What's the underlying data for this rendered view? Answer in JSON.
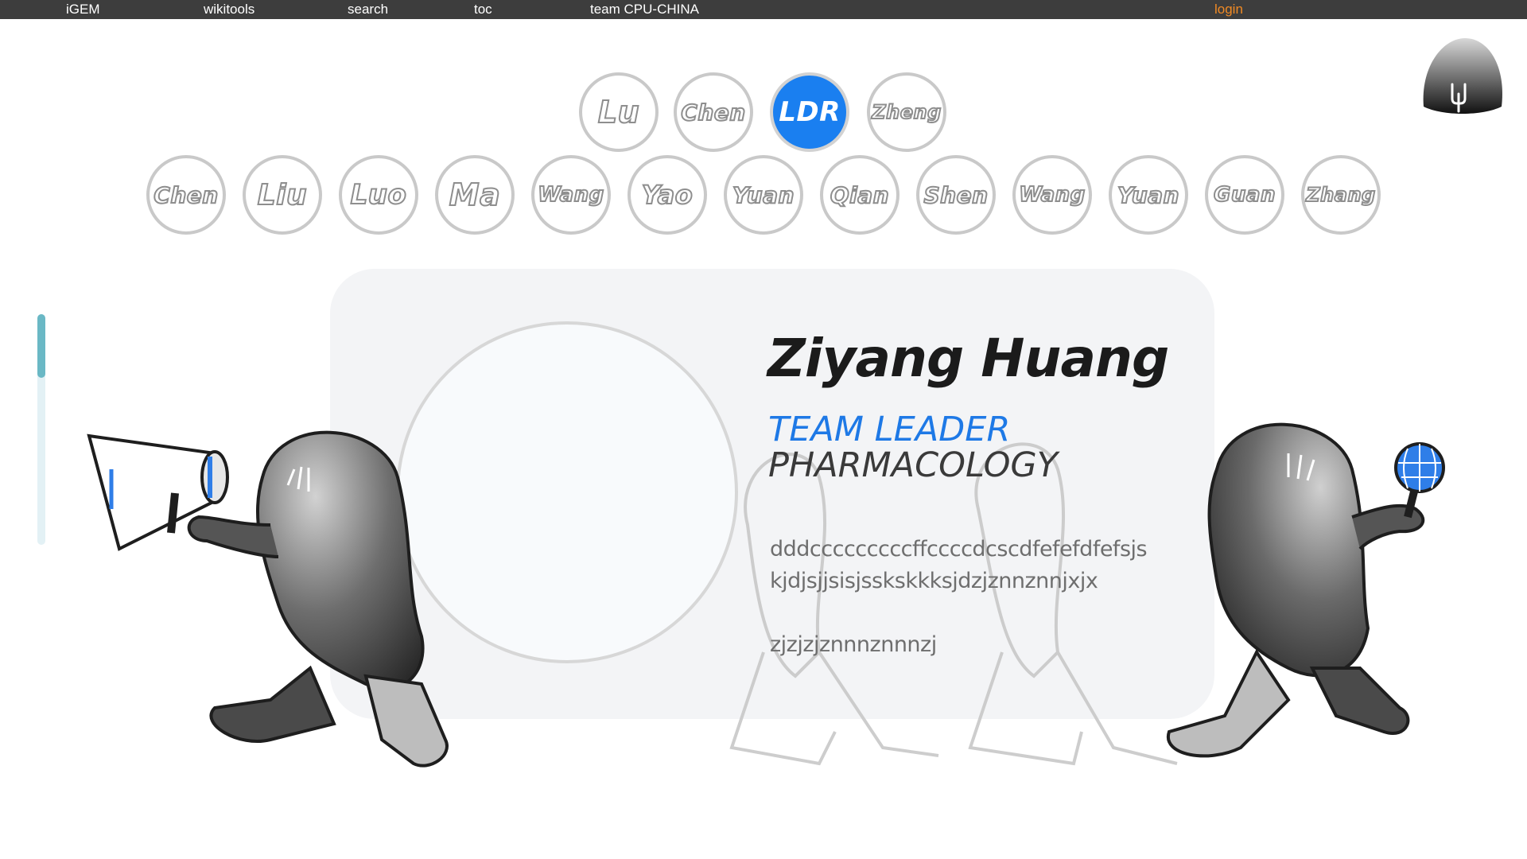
{
  "topbar": {
    "items": [
      "iGEM",
      "wikitools",
      "search",
      "toc",
      "team CPU-CHINA"
    ],
    "login": "login"
  },
  "members_row1": [
    "Lu",
    "Chen",
    "LDR",
    "Zheng"
  ],
  "members_row2": [
    "Chen",
    "Liu",
    "Luo",
    "Ma",
    "Wang",
    "Yao",
    "Yuan",
    "Qian",
    "Shen",
    "Wang",
    "Yuan",
    "Guan",
    "Zhang"
  ],
  "active_member": "LDR",
  "profile": {
    "name": "Ziyang Huang",
    "role": "TEAM LEADER",
    "field": "PHARMACOLOGY",
    "bio_lines": [
      "dddcccccccccffccccdcscdfefefdfefsjs",
      "kjdjsjjsisjsskskkksjdzjznnznnjxjx",
      "zjzjzjznnnznnnzj"
    ]
  },
  "logo_icon": "team-mascot-logo",
  "colors": {
    "accent_blue": "#1a7ff0",
    "login_orange": "#f08a24",
    "scroll_thumb": "#6ab8c5"
  }
}
